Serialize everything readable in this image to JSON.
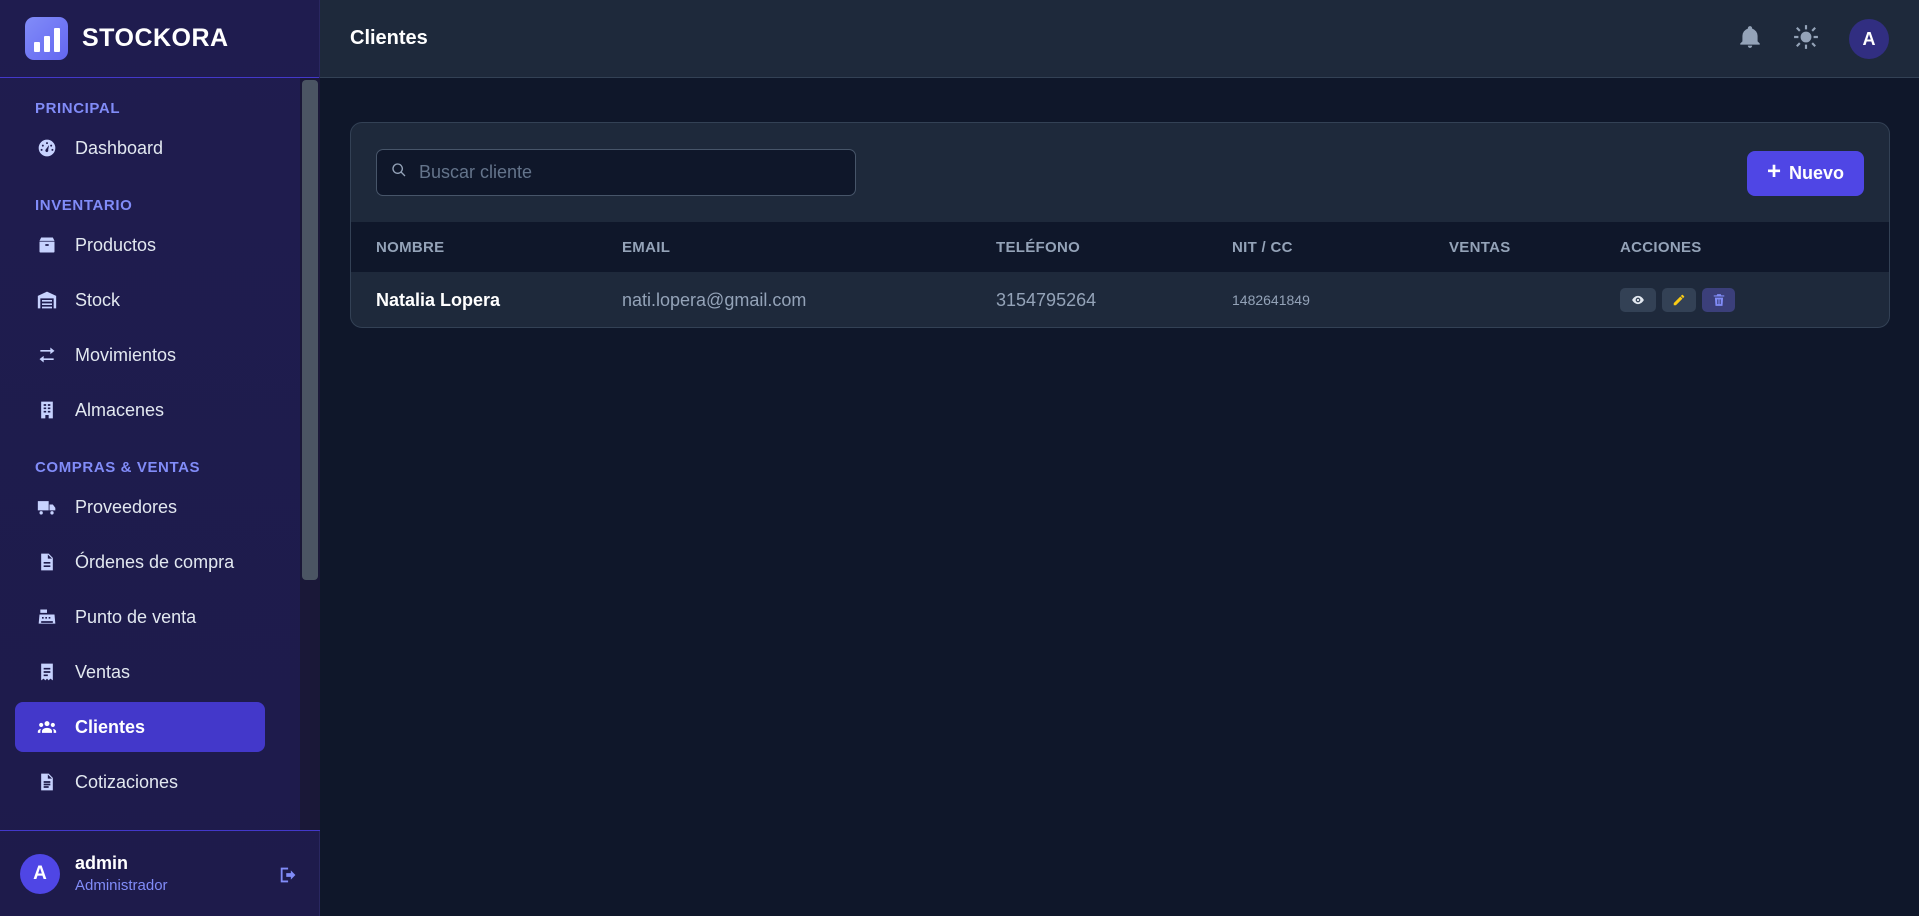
{
  "brand": {
    "name": "STOCKORA"
  },
  "sidebar": {
    "sections": [
      {
        "title": "PRINCIPAL",
        "items": [
          {
            "label": "Dashboard",
            "icon": "gauge-icon"
          }
        ]
      },
      {
        "title": "INVENTARIO",
        "items": [
          {
            "label": "Productos",
            "icon": "box-icon"
          },
          {
            "label": "Stock",
            "icon": "warehouse-icon"
          },
          {
            "label": "Movimientos",
            "icon": "arrows-exchange-icon"
          },
          {
            "label": "Almacenes",
            "icon": "building-icon"
          }
        ]
      },
      {
        "title": "COMPRAS & VENTAS",
        "items": [
          {
            "label": "Proveedores",
            "icon": "truck-icon"
          },
          {
            "label": "Órdenes de compra",
            "icon": "file-icon"
          },
          {
            "label": "Punto de venta",
            "icon": "cash-register-icon"
          },
          {
            "label": "Ventas",
            "icon": "receipt-icon"
          },
          {
            "label": "Clientes",
            "icon": "users-icon",
            "active": true
          },
          {
            "label": "Cotizaciones",
            "icon": "file-text-icon"
          }
        ]
      }
    ],
    "user": {
      "initial": "A",
      "name": "admin",
      "role": "Administrador"
    }
  },
  "header": {
    "title": "Clientes",
    "avatar_initial": "A"
  },
  "toolbar": {
    "search_placeholder": "Buscar cliente",
    "new_label": "Nuevo"
  },
  "table": {
    "columns": [
      "NOMBRE",
      "EMAIL",
      "TELÉFONO",
      "NIT / CC",
      "VENTAS",
      "ACCIONES"
    ],
    "rows": [
      {
        "nombre": "Natalia Lopera",
        "email": "nati.lopera@gmail.com",
        "telefono": "3154795264",
        "nit": "1482641849",
        "ventas": ""
      }
    ]
  },
  "colors": {
    "accent": "#4f46e5",
    "active_nav": "#4338ca",
    "sidebar_bg": "#1e1b4b",
    "main_bg": "#0f172a",
    "card_bg": "#1e293b",
    "edit_icon": "#facc15",
    "delete_icon": "#818cf8"
  }
}
